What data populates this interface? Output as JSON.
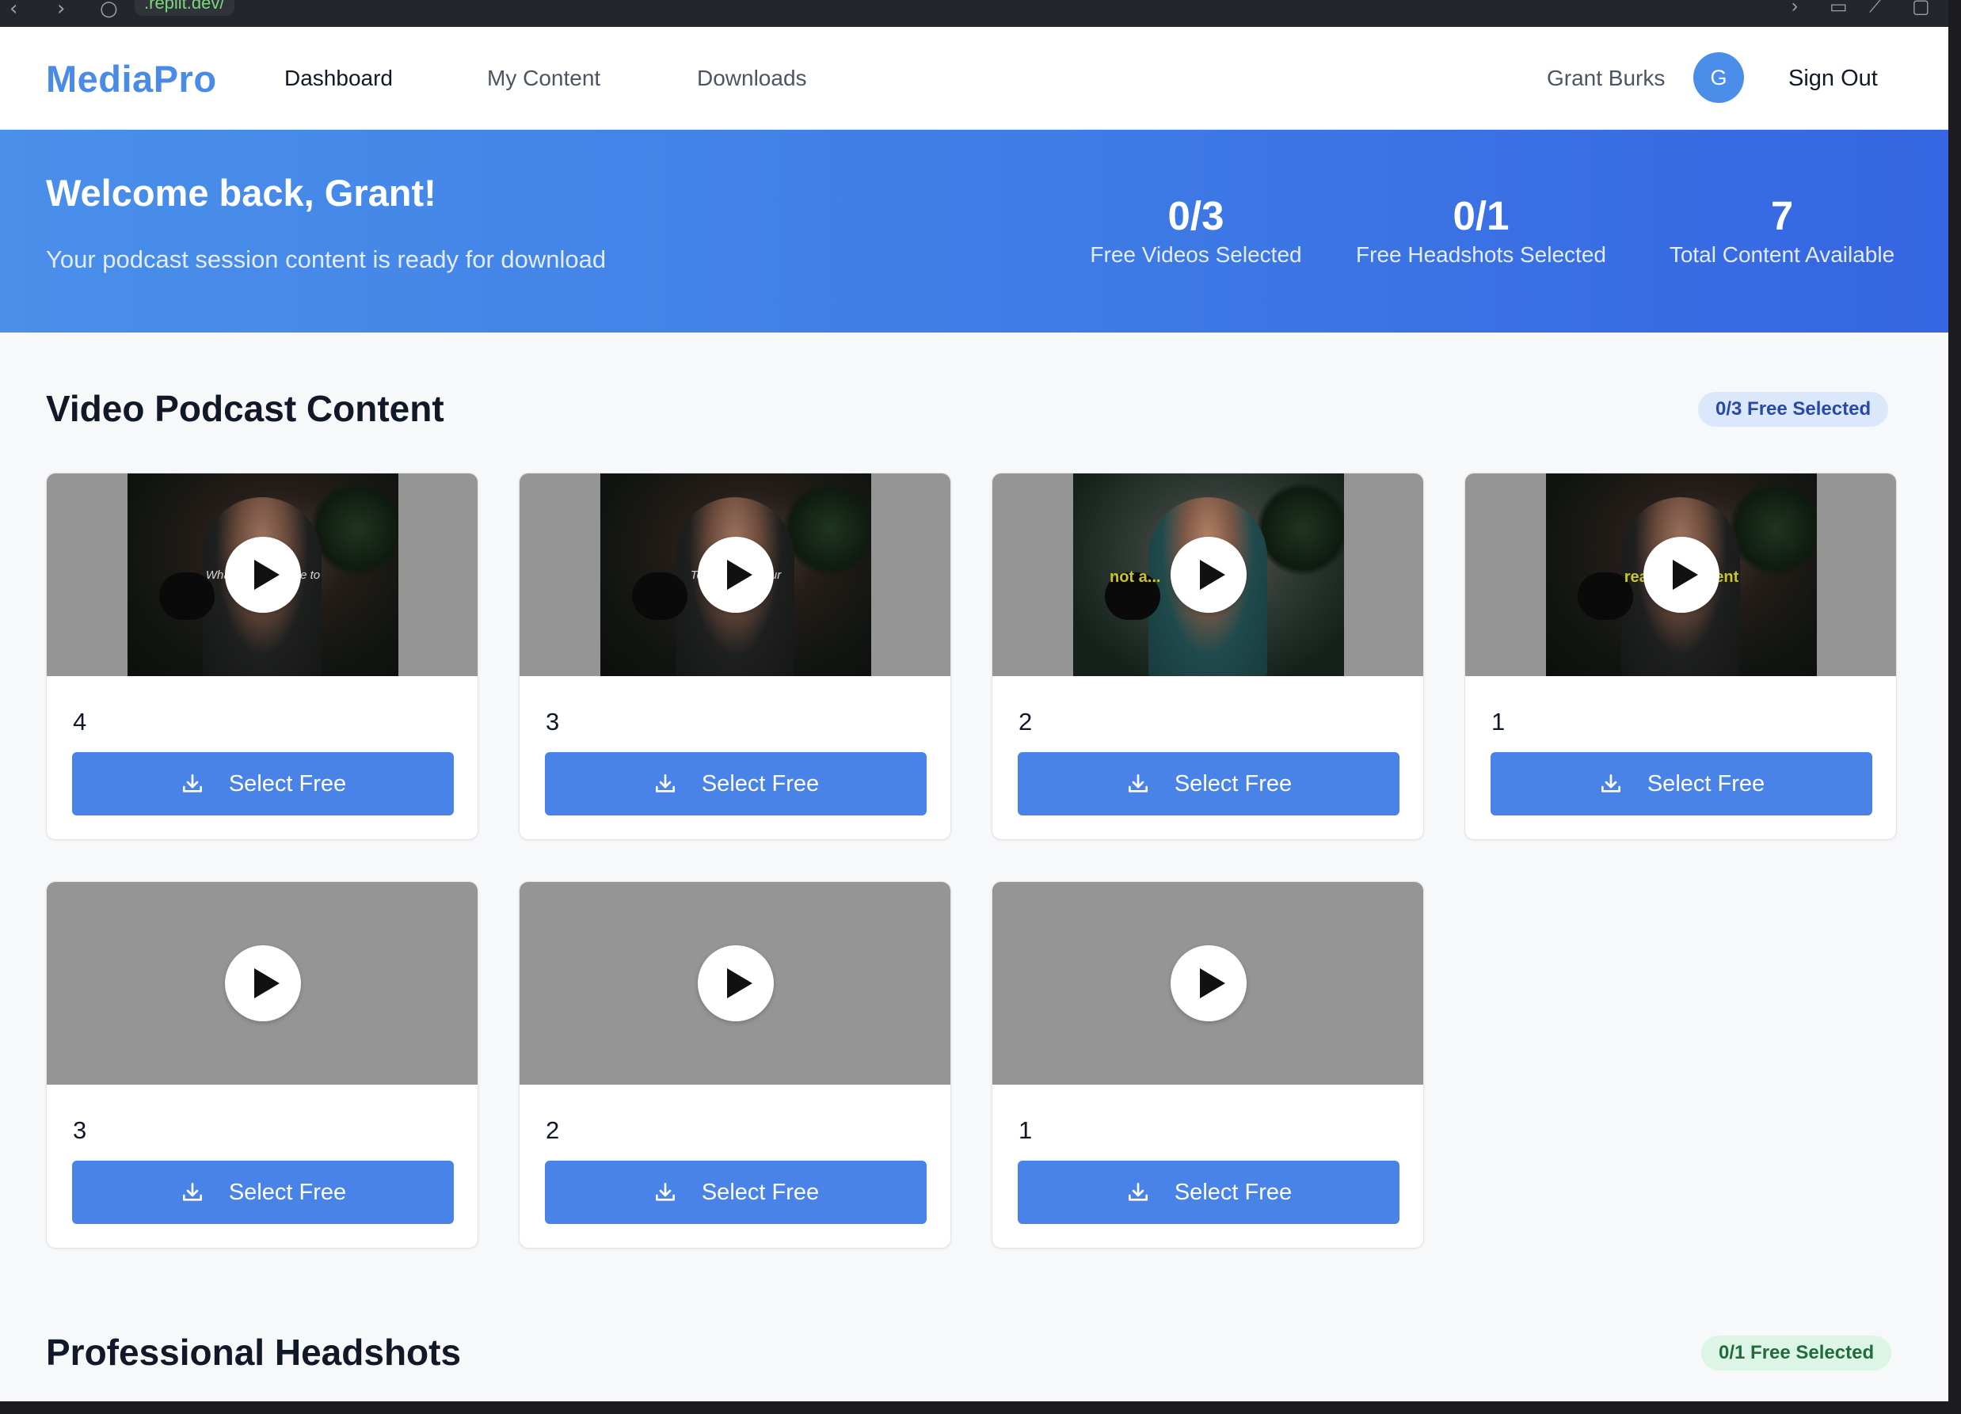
{
  "browser": {
    "url": ".replit.dev/"
  },
  "header": {
    "logo": "MediaPro",
    "nav": [
      {
        "label": "Dashboard"
      },
      {
        "label": "My Content"
      },
      {
        "label": "Downloads"
      }
    ],
    "user_name": "Grant Burks",
    "avatar_initial": "G",
    "sign_out": "Sign Out"
  },
  "hero": {
    "title": "Welcome back, Grant!",
    "subtitle": "Your podcast session content is ready for download",
    "stats": [
      {
        "value": "0/3",
        "label": "Free Videos Selected"
      },
      {
        "value": "0/1",
        "label": "Free Headshots Selected"
      },
      {
        "value": "7",
        "label": "Total Content Available"
      }
    ]
  },
  "video_section": {
    "title": "Video Podcast Content",
    "badge": "0/3 Free Selected",
    "cards": [
      {
        "label": "4",
        "caption": "What wo... ...ice be to",
        "button": "Select Free"
      },
      {
        "label": "3",
        "caption": "Tell m... ...of your",
        "button": "Select Free"
      },
      {
        "label": "2",
        "caption": "not a...",
        "button": "Select Free"
      },
      {
        "label": "1",
        "caption": "real e... ...agent",
        "button": "Select Free"
      },
      {
        "label": "3",
        "button": "Select Free"
      },
      {
        "label": "2",
        "button": "Select Free"
      },
      {
        "label": "1",
        "button": "Select Free"
      }
    ]
  },
  "headshot_section": {
    "title": "Professional Headshots",
    "badge": "0/1 Free Selected"
  },
  "colors": {
    "brand": "#4b8be8",
    "button": "#4a83e8",
    "hero_start": "#4a8fea",
    "hero_end": "#3565e2"
  },
  "icons": {
    "play": "play-icon",
    "download": "download-icon"
  }
}
